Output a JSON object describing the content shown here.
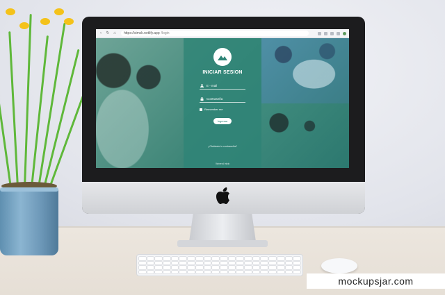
{
  "browser": {
    "url_host": "https://simck.netlify.app",
    "url_path": "/login"
  },
  "login": {
    "title": "INICIAR SESION",
    "email_placeholder": "E - mail",
    "password_placeholder": "Contraseña",
    "remember_label": "Remember me",
    "submit_label": "Ingresar",
    "forgot_link": "¿Olvidaste tu contraseña?",
    "back_link": "Volver al inicio"
  },
  "watermark": "mockupsjar.com",
  "colors": {
    "panel": "#2e8476",
    "accent": "#ffffff",
    "flowers": "#f4c21a"
  }
}
